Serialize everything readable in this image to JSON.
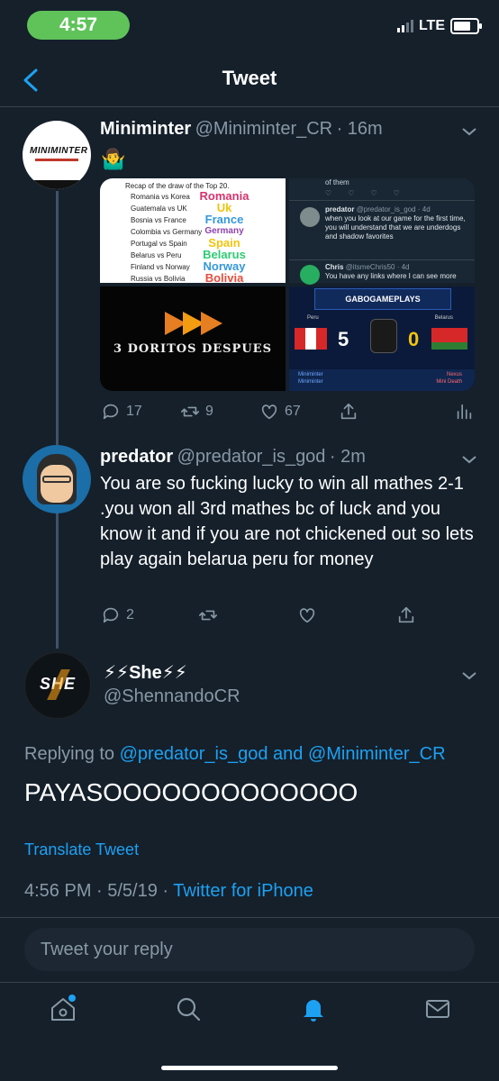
{
  "status_bar": {
    "time": "4:57",
    "network": "LTE"
  },
  "header": {
    "title": "Tweet"
  },
  "tweets": [
    {
      "name": "Miniminter",
      "handle": "@Miniminter_CR",
      "time": "· 16m",
      "emoji": "🤷‍♂️",
      "avatar_text": "MINIMINTER",
      "media": {
        "recap_title": "Recap of the draw of the Top 20.",
        "recap_rows": [
          "Romania vs Korea",
          "Guatemala vs UK",
          "Bosnia vs France",
          "Colombia vs Germany",
          "Portugal vs Spain",
          "Belarus vs Peru",
          "Finland vs Norway",
          "Russia vs Bolivia"
        ],
        "recap_countries": [
          "Romania",
          "Uk",
          "France",
          "Germany",
          "Spain",
          "Belarus",
          "Norway",
          "Bolivia"
        ],
        "doritos_text": "3 DORITOS DESPUES",
        "embed_top": "of them",
        "embed_user": "predator",
        "embed_handle": "@predator_is_god · 4d",
        "embed_text": "when you look at our game for the first time, you will understand that we are underdogs and shadow favorites",
        "embed_user2": "Chris",
        "embed_handle2": "@itsmeChris50 · 4d",
        "embed_text2": "You have any links where I can see more",
        "score_brand": "GABOGAMEPLAYS",
        "score_left_team": "Peru",
        "score_right_team": "Belarus",
        "score_left": "5",
        "score_right": "0",
        "score_player1": "Miniminter",
        "score_player2": "Miniminter",
        "score_opp1": "Nexus",
        "score_opp2": "Mini Death"
      },
      "actions": {
        "replies": "17",
        "retweets": "9",
        "likes": "67"
      }
    },
    {
      "name": "predator",
      "handle": "@predator_is_god",
      "time": "· 2m",
      "text": "You are so fucking lucky to win all mathes 2-1 .you won all 3rd mathes bc of luck and you know it and if you are not chickened out so lets play again belarua peru for money",
      "actions": {
        "replies": "2",
        "retweets": "",
        "likes": ""
      }
    },
    {
      "name": "⚡⚡She⚡⚡",
      "handle": "@ShennandoCR",
      "avatar_text": "SHE",
      "replying_prefix": "Replying to",
      "replying_to": "@predator_is_god and @Miniminter_CR",
      "text": "PAYASOOOOOOOOOOOOO",
      "translate": "Translate Tweet",
      "timestamp": "4:56 PM · 5/5/19 ·",
      "source": "Twitter for iPhone"
    }
  ],
  "reply_box": {
    "placeholder": "Tweet your reply"
  },
  "colors": {
    "background": "#15202b",
    "accent": "#1da1f2",
    "muted": "#8899a6",
    "divider": "#38444d"
  }
}
